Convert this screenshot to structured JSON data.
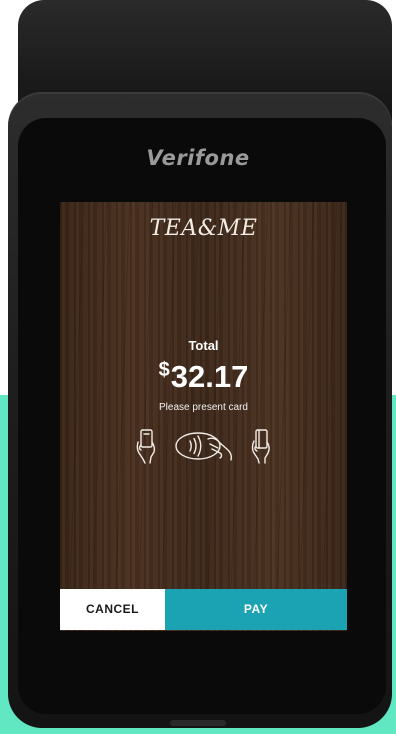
{
  "device": {
    "brand": "Verifone"
  },
  "merchant": {
    "logo_text": "TEA&ME"
  },
  "payment": {
    "total_label": "Total",
    "currency_symbol": "$",
    "amount": "32.17",
    "prompt": "Please present card"
  },
  "payment_methods": [
    {
      "icon": "card-insert-icon"
    },
    {
      "icon": "contactless-tap-icon"
    },
    {
      "icon": "card-swipe-icon"
    }
  ],
  "actions": {
    "cancel_label": "CANCEL",
    "pay_label": "PAY"
  },
  "colors": {
    "pay_button": "#1ca3b3",
    "cancel_button": "#ffffff",
    "background_accent": "#61e8c2",
    "screen_wood": "#3f2a1b"
  }
}
